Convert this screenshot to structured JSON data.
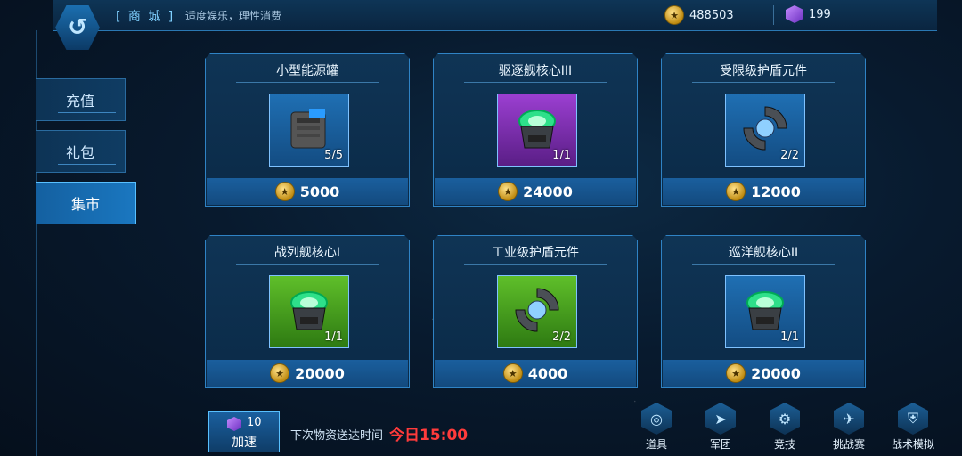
{
  "header": {
    "title": "[ 商 城 ]",
    "tagline": "适度娱乐，理性消费",
    "gold": "488503",
    "gems": "199"
  },
  "sidebar": {
    "items": [
      {
        "label": "充值"
      },
      {
        "label": "礼包"
      },
      {
        "label": "集市",
        "active": true
      }
    ]
  },
  "items": [
    {
      "name": "小型能源罐",
      "count": "5/5",
      "price": "5000",
      "rarity": "blue",
      "art": "energy-canister"
    },
    {
      "name": "驱逐舰核心III",
      "count": "1/1",
      "price": "24000",
      "rarity": "purple",
      "art": "ship-core"
    },
    {
      "name": "受限级护盾元件",
      "count": "2/2",
      "price": "12000",
      "rarity": "blue",
      "art": "shield-component"
    },
    {
      "name": "战列舰核心I",
      "count": "1/1",
      "price": "20000",
      "rarity": "green",
      "art": "ship-core"
    },
    {
      "name": "工业级护盾元件",
      "count": "2/2",
      "price": "4000",
      "rarity": "green",
      "art": "shield-component"
    },
    {
      "name": "巡洋舰核心II",
      "count": "1/1",
      "price": "20000",
      "rarity": "blue",
      "art": "ship-core"
    }
  ],
  "bottom": {
    "speed_count": "10",
    "speed_label": "加速",
    "next_label": "下次物资送达时间",
    "next_time": "今日15:00"
  },
  "bottom_nav": [
    {
      "label": "道具",
      "icon": "planet-icon"
    },
    {
      "label": "军团",
      "icon": "ship-icon"
    },
    {
      "label": "竞技",
      "icon": "robot-arm-icon"
    },
    {
      "label": "挑战赛",
      "icon": "fighter-icon"
    },
    {
      "label": "战术模拟",
      "icon": "shield-icon"
    }
  ],
  "colors": {
    "accent": "#2f83c5",
    "alert": "#ff3b3b",
    "gold": "#e0b030"
  }
}
